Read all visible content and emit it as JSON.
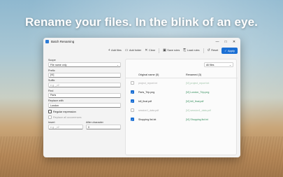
{
  "headline": "Rename your files. In the blink of an eye.",
  "window": {
    "title": "Batch Renaming",
    "controls": [
      "—",
      "□",
      "✕"
    ]
  },
  "toolbar": {
    "add_files": "Add files",
    "add_folder": "Add folder",
    "clear": "Clear",
    "save_rules": "Save rules",
    "load_rules": "Load rules",
    "reset": "Reset",
    "apply": "Apply"
  },
  "form": {
    "scope_label": "Scope",
    "scope_value": "File name only",
    "prefix_label": "Prefix",
    "prefix_value": "[VI]",
    "suffix_label": "Suffix",
    "suffix_placeholder": "e.g. _v2",
    "find_label": "Find",
    "find_value": "Paris",
    "replace_label": "Replace with",
    "replace_value": "London",
    "regex_label": "Regular expression",
    "replace_all_label": "Replace all occurrences",
    "insert_label": "Insert",
    "insert_placeholder": "e.g. _v2",
    "after_char_label": "After character",
    "after_char_value": "0"
  },
  "filter": {
    "value": "All files"
  },
  "table": {
    "headers": {
      "original": "Original name (5)",
      "renamed": "Renamed (3)"
    },
    "rows": [
      {
        "checked": false,
        "original": "project_report.txt",
        "renamed": "[VI] project_report.txt"
      },
      {
        "checked": true,
        "original": "Paris_Trip.png",
        "renamed": "[VI] London_Trip.png"
      },
      {
        "checked": true,
        "original": "bill_final.pdf",
        "renamed": "[VI] bill_final.pdf"
      },
      {
        "checked": false,
        "original": "session1_data.pdf",
        "renamed": "[VI] session1_data.pdf"
      },
      {
        "checked": true,
        "original": "Shopping list.txt",
        "renamed": "[VI] Shopping list.txt"
      }
    ]
  }
}
